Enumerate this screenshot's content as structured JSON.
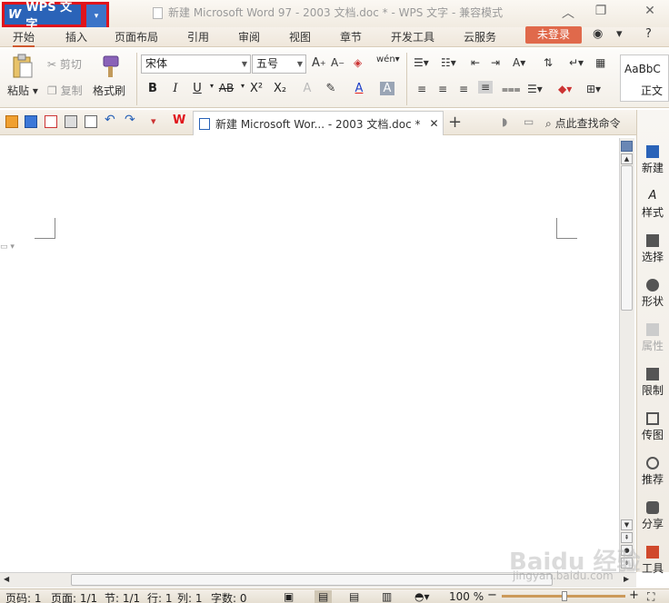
{
  "titlebar": {
    "app_name": "WPS 文字",
    "dropdown_glyph": "▾",
    "doc_title": "新建 Microsoft Word 97 - 2003 文档.doc * - WPS 文字 - 兼容模式",
    "minimize": "︿",
    "restore": "❐",
    "close": "✕"
  },
  "menu": {
    "tabs": [
      "开始",
      "插入",
      "页面布局",
      "引用",
      "审阅",
      "视图",
      "章节",
      "开发工具",
      "云服务"
    ],
    "login": "未登录",
    "help": "?"
  },
  "ribbon": {
    "paste": "粘贴",
    "cut": "剪切",
    "copy": "复制",
    "format_painter": "格式刷",
    "font_name": "宋体",
    "font_size": "五号",
    "bold": "B",
    "italic": "I",
    "underline": "U",
    "strike": "AB",
    "superscript": "X²",
    "subscript": "X₂",
    "font_color": "A",
    "style_preview": "AaBbC",
    "style_name": "正文"
  },
  "quickbar": {
    "doc_tab_title": "新建 Microsoft Wor... - 2003 文档.doc *",
    "tab_close": "✕",
    "new_tab": "+",
    "find_command": "点此查找命令"
  },
  "rightpane": {
    "items": [
      {
        "label": "新建",
        "disabled": false
      },
      {
        "label": "样式",
        "disabled": false
      },
      {
        "label": "选择",
        "disabled": false
      },
      {
        "label": "形状",
        "disabled": false
      },
      {
        "label": "属性",
        "disabled": true
      },
      {
        "label": "限制",
        "disabled": false
      },
      {
        "label": "传图",
        "disabled": false
      },
      {
        "label": "推荐",
        "disabled": false
      },
      {
        "label": "分享",
        "disabled": false
      },
      {
        "label": "工具",
        "disabled": false
      }
    ]
  },
  "statusbar": {
    "page_no": "页码: 1",
    "pages": "页面: 1/1",
    "section": "节: 1/1",
    "row": "行: 1",
    "col": "列: 1",
    "word_count": "字数: 0",
    "zoom": "100 %",
    "zoom_minus": "−",
    "zoom_plus": "+",
    "zoom_level": 1.0
  },
  "watermark": {
    "text": "Baidu 经验",
    "url": "jingyan.baidu.com"
  },
  "colors": {
    "accent_blue": "#2a63b8",
    "highlight_red": "#e0141b",
    "login_orange": "#e0694b"
  }
}
